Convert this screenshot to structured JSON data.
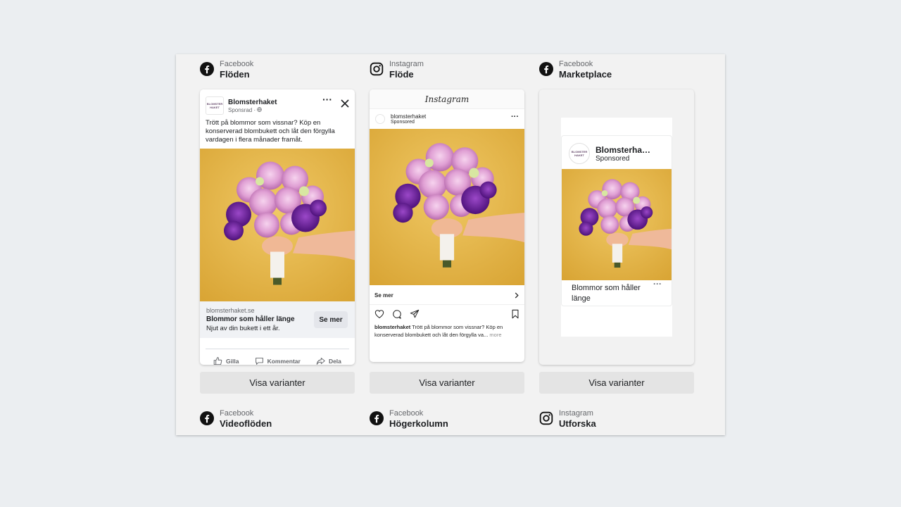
{
  "columns": [
    {
      "platform": "Facebook",
      "placement": "Flöden",
      "platform_icon": "facebook-icon"
    },
    {
      "platform": "Instagram",
      "placement": "Flöde",
      "platform_icon": "instagram-icon"
    },
    {
      "platform": "Facebook",
      "placement": "Marketplace",
      "platform_icon": "facebook-icon"
    }
  ],
  "bottom_row": [
    {
      "platform": "Facebook",
      "placement": "Videoflöden",
      "platform_icon": "facebook-icon"
    },
    {
      "platform": "Facebook",
      "placement": "Högerkolumn",
      "platform_icon": "facebook-icon"
    },
    {
      "platform": "Instagram",
      "placement": "Utforska",
      "platform_icon": "instagram-icon"
    }
  ],
  "variant_button_label": "Visa varianter",
  "fb_feed": {
    "page_name": "Blomsterhaket",
    "sponsored": "Sponsrad · ",
    "logo_text_line1": "BLOMSTER",
    "logo_text_line2": "HAKET",
    "primary_text": "Trött på blommor som vissnar? Köp en konserverad blombukett och låt den förgylla vardagen i flera månader framåt.",
    "domain": "blomsterhaket.se",
    "headline": "Blommor som håller länge",
    "description": "Njut av din bukett i ett år.",
    "cta": "Se mer",
    "actions": {
      "like": "Gilla",
      "comment": "Kommentar",
      "share": "Dela"
    }
  },
  "ig_feed": {
    "wordmark": "Instagram",
    "account": "blomsterhaket",
    "sponsored": "Sponsored",
    "cta": "Se mer",
    "caption_account": "blomsterhaket",
    "caption_text": " Trött på blommor som vissnar? Köp en konserverad blombukett och låt den förgylla va...",
    "more": " more"
  },
  "marketplace": {
    "page_name": "Blomsterhaket",
    "sponsored": "Sponsored",
    "title": "Blommor som håller länge"
  },
  "colors": {
    "background": "#ebeef1",
    "panel": "#f2f2f2",
    "photo_background": "#e9bb4f",
    "flower_pink": "#dd9bd2",
    "flower_purple": "#6a1f9e"
  }
}
